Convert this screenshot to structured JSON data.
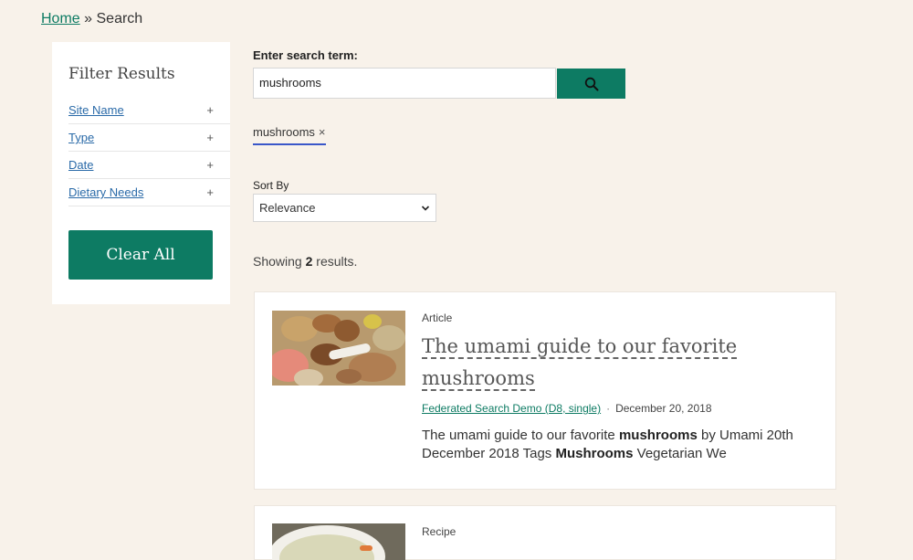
{
  "breadcrumb": {
    "home": "Home",
    "separator": "»",
    "current": "Search"
  },
  "sidebar": {
    "title": "Filter Results",
    "facets": [
      {
        "label": "Site Name",
        "toggle": "+"
      },
      {
        "label": "Type",
        "toggle": "+"
      },
      {
        "label": "Date",
        "toggle": "+"
      },
      {
        "label": "Dietary Needs",
        "toggle": "+"
      }
    ],
    "clear_label": "Clear All"
  },
  "search": {
    "label": "Enter search term:",
    "value": "mushrooms",
    "button_icon": "search-icon"
  },
  "active_filter": {
    "label": "mushrooms",
    "remove": "×"
  },
  "sort": {
    "label": "Sort By",
    "selected": "Relevance"
  },
  "summary": {
    "prefix": "Showing",
    "count": "2",
    "suffix": "results."
  },
  "results": [
    {
      "type": "Article",
      "title_line1": "The umami guide to our favorite",
      "title_line2": "mushrooms",
      "site": "Federated Search Demo (D8, single)",
      "dot": "·",
      "date": "December 20, 2018",
      "snippet": [
        {
          "text": "The umami guide to our favorite ",
          "bold": false
        },
        {
          "text": "mushrooms",
          "bold": true
        },
        {
          "text": " by Umami 20th December 2018 Tags ",
          "bold": false
        },
        {
          "text": "Mushrooms",
          "bold": true
        },
        {
          "text": " Vegetarian We",
          "bold": false
        }
      ]
    },
    {
      "type": "Recipe"
    }
  ],
  "colors": {
    "accent": "#0d7b63",
    "background": "#f8f2ea",
    "link_blue": "#2a6aa8",
    "chip_underline": "#3a57c9"
  }
}
